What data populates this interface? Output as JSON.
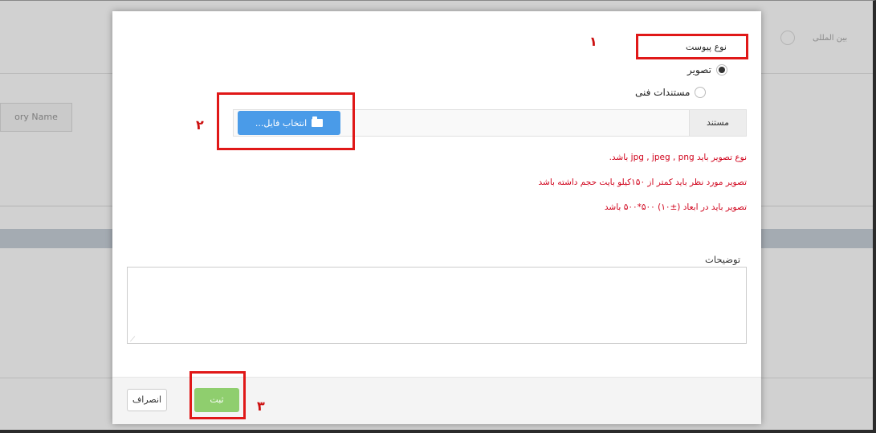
{
  "background": {
    "nav_text": "بین المللی",
    "category_placeholder": "ory Name"
  },
  "modal": {
    "attachment_type_label": "نوع پیوست",
    "radio_options": [
      {
        "label": "تصویر",
        "checked": true
      },
      {
        "label": "مستندات فنی",
        "checked": false
      }
    ],
    "file_field_label": "مستند",
    "choose_file_button": "انتخاب فایل...",
    "hints": [
      "نوع تصویر باید jpg , jpeg , png باشد.",
      "تصویر مورد نظر باید کمتر از ۱۵۰کیلو بایت حجم داشته باشد",
      "تصویر باید در ابعاد (±۱۰) ۵۰۰*۵۰۰ باشد"
    ],
    "description_label": "توضیحات",
    "description_value": "",
    "cancel_button": "انصراف",
    "submit_button": "ثبت"
  },
  "annotations": {
    "step_1": "۱",
    "step_2": "۲",
    "step_3": "۳",
    "highlight_color": "#e01818"
  },
  "colors": {
    "primary_button": "#4a9be8",
    "submit_button": "#8fce6e",
    "hint_text": "#d0021b"
  }
}
